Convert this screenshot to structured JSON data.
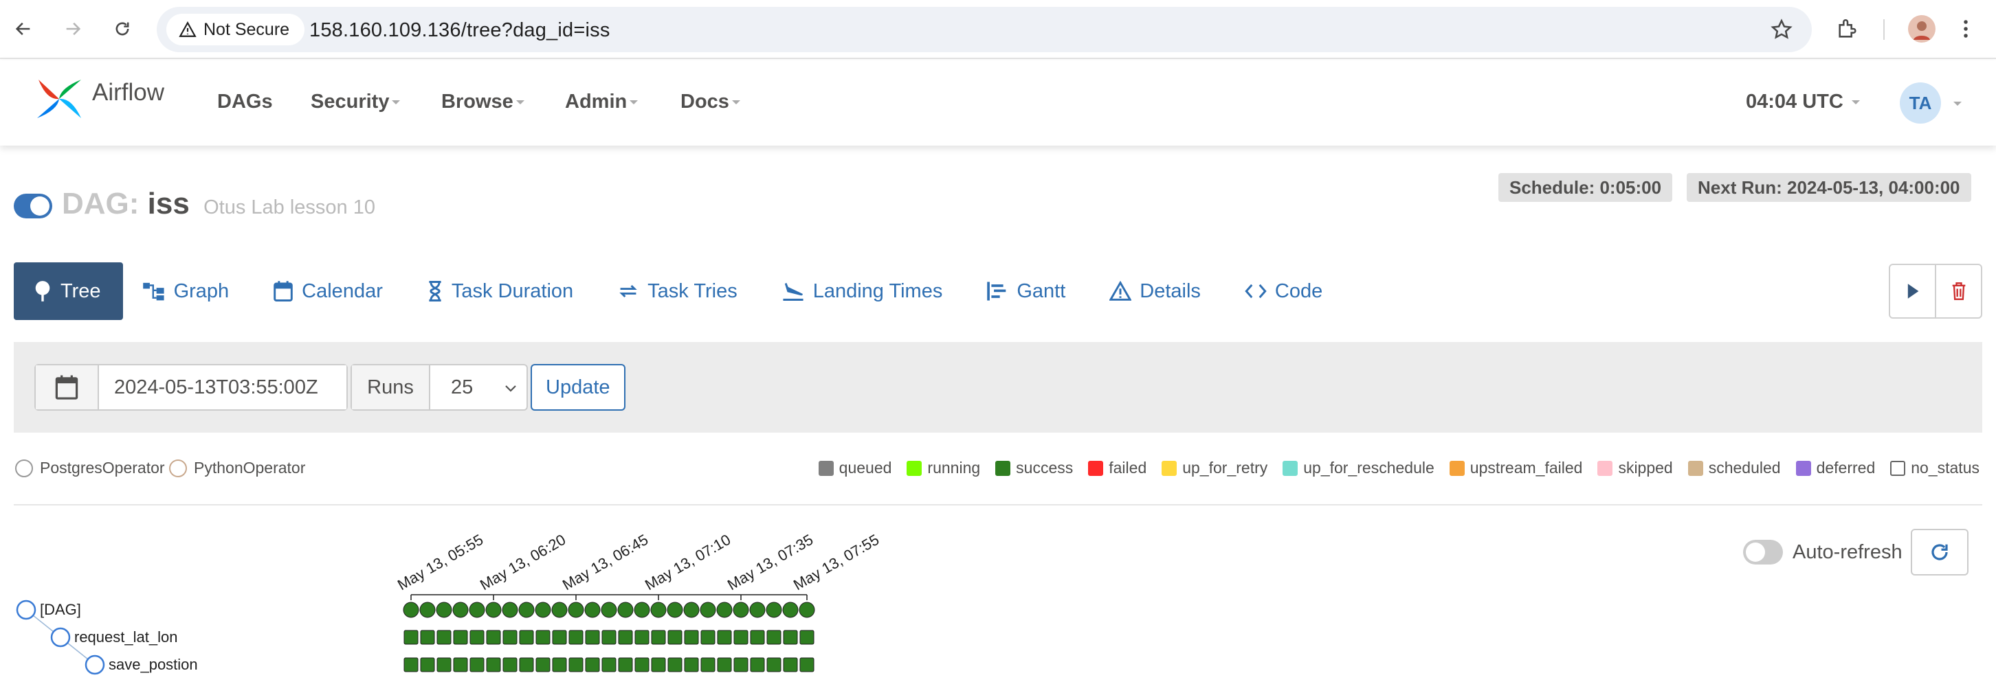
{
  "browser": {
    "security_label": "Not Secure",
    "url": "158.160.109.136/tree?dag_id=iss"
  },
  "navbar": {
    "brand": "Airflow",
    "menu": [
      {
        "label": "DAGs",
        "dropdown": false
      },
      {
        "label": "Security",
        "dropdown": true
      },
      {
        "label": "Browse",
        "dropdown": true
      },
      {
        "label": "Admin",
        "dropdown": true
      },
      {
        "label": "Docs",
        "dropdown": true
      }
    ],
    "clock": "04:04 UTC",
    "user_initials": "TA"
  },
  "dag": {
    "prefix": "DAG:",
    "id": "iss",
    "description": "Otus Lab lesson 10",
    "paused": false,
    "schedule": "Schedule: 0:05:00",
    "next_run": "Next Run: 2024-05-13, 04:00:00"
  },
  "tabs": [
    {
      "label": "Tree",
      "icon": "tree-icon",
      "active": true
    },
    {
      "label": "Graph",
      "icon": "graph-icon",
      "active": false
    },
    {
      "label": "Calendar",
      "icon": "calendar-icon",
      "active": false
    },
    {
      "label": "Task Duration",
      "icon": "hourglass-icon",
      "active": false
    },
    {
      "label": "Task Tries",
      "icon": "retry-icon",
      "active": false
    },
    {
      "label": "Landing Times",
      "icon": "plane-landing-icon",
      "active": false
    },
    {
      "label": "Gantt",
      "icon": "gantt-icon",
      "active": false
    },
    {
      "label": "Details",
      "icon": "warning-triangle-icon",
      "active": false
    },
    {
      "label": "Code",
      "icon": "code-icon",
      "active": false
    }
  ],
  "filters": {
    "base_date": "2024-05-13T03:55:00Z",
    "runs_label": "Runs",
    "runs_value": "25",
    "update_label": "Update"
  },
  "operators": [
    "PostgresOperator",
    "PythonOperator"
  ],
  "legend": [
    {
      "label": "queued",
      "color": "#808080"
    },
    {
      "label": "running",
      "color": "#7cfc00"
    },
    {
      "label": "success",
      "color": "#2e7d20"
    },
    {
      "label": "failed",
      "color": "#ff2a2a"
    },
    {
      "label": "up_for_retry",
      "color": "#ffd83d"
    },
    {
      "label": "up_for_reschedule",
      "color": "#75dccf"
    },
    {
      "label": "upstream_failed",
      "color": "#f5a23a"
    },
    {
      "label": "skipped",
      "color": "#ffc0cb"
    },
    {
      "label": "scheduled",
      "color": "#d2b48c"
    },
    {
      "label": "deferred",
      "color": "#9370db"
    },
    {
      "label": "no_status",
      "color": "#ffffff"
    }
  ],
  "autorefresh_label": "Auto-refresh",
  "tree": {
    "run_count": 25,
    "date_labels": [
      "May 13, 05:55",
      "May 13, 06:20",
      "May 13, 06:45",
      "May 13, 07:10",
      "May 13, 07:35",
      "May 13, 07:55"
    ],
    "nodes": [
      {
        "label": "[DAG]",
        "depth": 0,
        "state": "success",
        "shape": "circle"
      },
      {
        "label": "request_lat_lon",
        "depth": 1,
        "state": "success",
        "shape": "square"
      },
      {
        "label": "save_postion",
        "depth": 2,
        "state": "success",
        "shape": "square"
      }
    ]
  }
}
